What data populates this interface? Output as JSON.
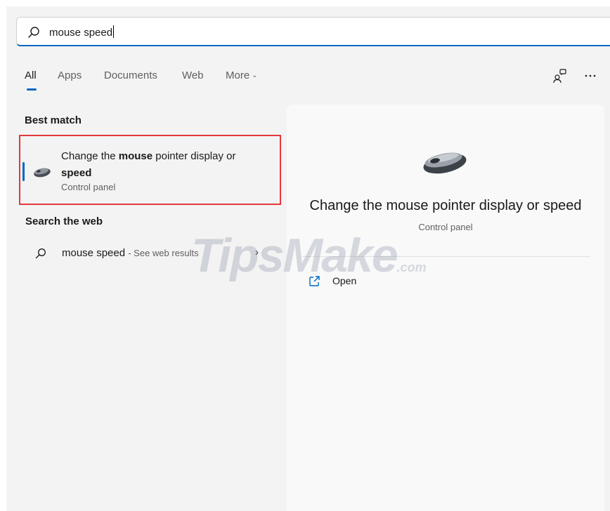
{
  "search": {
    "query": "mouse speed"
  },
  "tabs": [
    {
      "label": "All",
      "active": true
    },
    {
      "label": "Apps"
    },
    {
      "label": "Documents"
    },
    {
      "label": "Web"
    },
    {
      "label": "More"
    }
  ],
  "toolbar": {
    "icons": [
      "share-people-icon",
      "more-options-icon"
    ]
  },
  "best_match": {
    "section_title": "Best match",
    "title_part1": "Change the ",
    "title_bold1": "mouse",
    "title_part2": " pointer display or ",
    "title_bold2": "speed",
    "subtitle": "Control panel",
    "icon": "mouse-icon"
  },
  "search_web": {
    "section_title": "Search the web",
    "query": "mouse speed",
    "hint": "- See web results"
  },
  "detail": {
    "title": "Change the mouse pointer display or speed",
    "subtitle": "Control panel",
    "actions": [
      {
        "label": "Open",
        "icon": "open-external-icon"
      }
    ]
  },
  "watermark": {
    "text_main": "TipsMake",
    "text_domain": ".com"
  },
  "colors": {
    "accent": "#0067c0",
    "highlight_border": "#e5383b",
    "panel_bg": "#f3f3f3",
    "detail_bg": "#f9f9f9"
  }
}
